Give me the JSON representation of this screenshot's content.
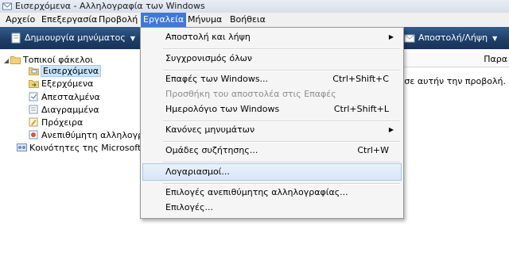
{
  "window": {
    "title": "Εισερχόμενα - Αλληλογραφία των Windows"
  },
  "menubar": {
    "file": "Αρχείο",
    "edit": "Επεξεργασία",
    "view": "Προβολή",
    "tools": "Εργαλεία",
    "message": "Μήνυμα",
    "help": "Βοήθεια"
  },
  "toolbar": {
    "create_mail": "Δημιουργία μηνύματος",
    "send_receive": "Αποστολή/Λήψη"
  },
  "folders": {
    "local": "Τοπικοί φάκελοι",
    "inbox": "Εισερχόμενα",
    "outbox": "Εξερχόμενα",
    "sent": "Απεσταλμένα",
    "deleted": "Διαγραμμένα",
    "drafts": "Πρόχειρα",
    "junk": "Ανεπιθύμητη αλληλογραφ",
    "communities": "Κοινότητες της Microsoft"
  },
  "message_list": {
    "column_header": "Παρα",
    "empty_text": "χεία σε αυτήν την προβολή."
  },
  "tools_menu": {
    "send_receive": "Αποστολή και λήψη",
    "sync_all": "Συγχρονισμός όλων",
    "contacts": "Επαφές των Windows...",
    "contacts_shortcut": "Ctrl+Shift+C",
    "add_sender": "Προσθήκη του αποστολέα στις Επαφές",
    "calendar": "Ημερολόγιο των Windows",
    "calendar_shortcut": "Ctrl+Shift+L",
    "rules": "Κανόνες μηνυμάτων",
    "newsgroups": "Ομάδες συζήτησης...",
    "newsgroups_shortcut": "Ctrl+W",
    "accounts": "Λογαριασμοί...",
    "junk_options": "Επιλογές ανεπιθύμητης αλληλογραφίας...",
    "options": "Επιλογές..."
  },
  "colors": {
    "menu_highlight": "#3f78d8",
    "toolbar": "#1f3e68",
    "hover": "#d8e6f8"
  }
}
